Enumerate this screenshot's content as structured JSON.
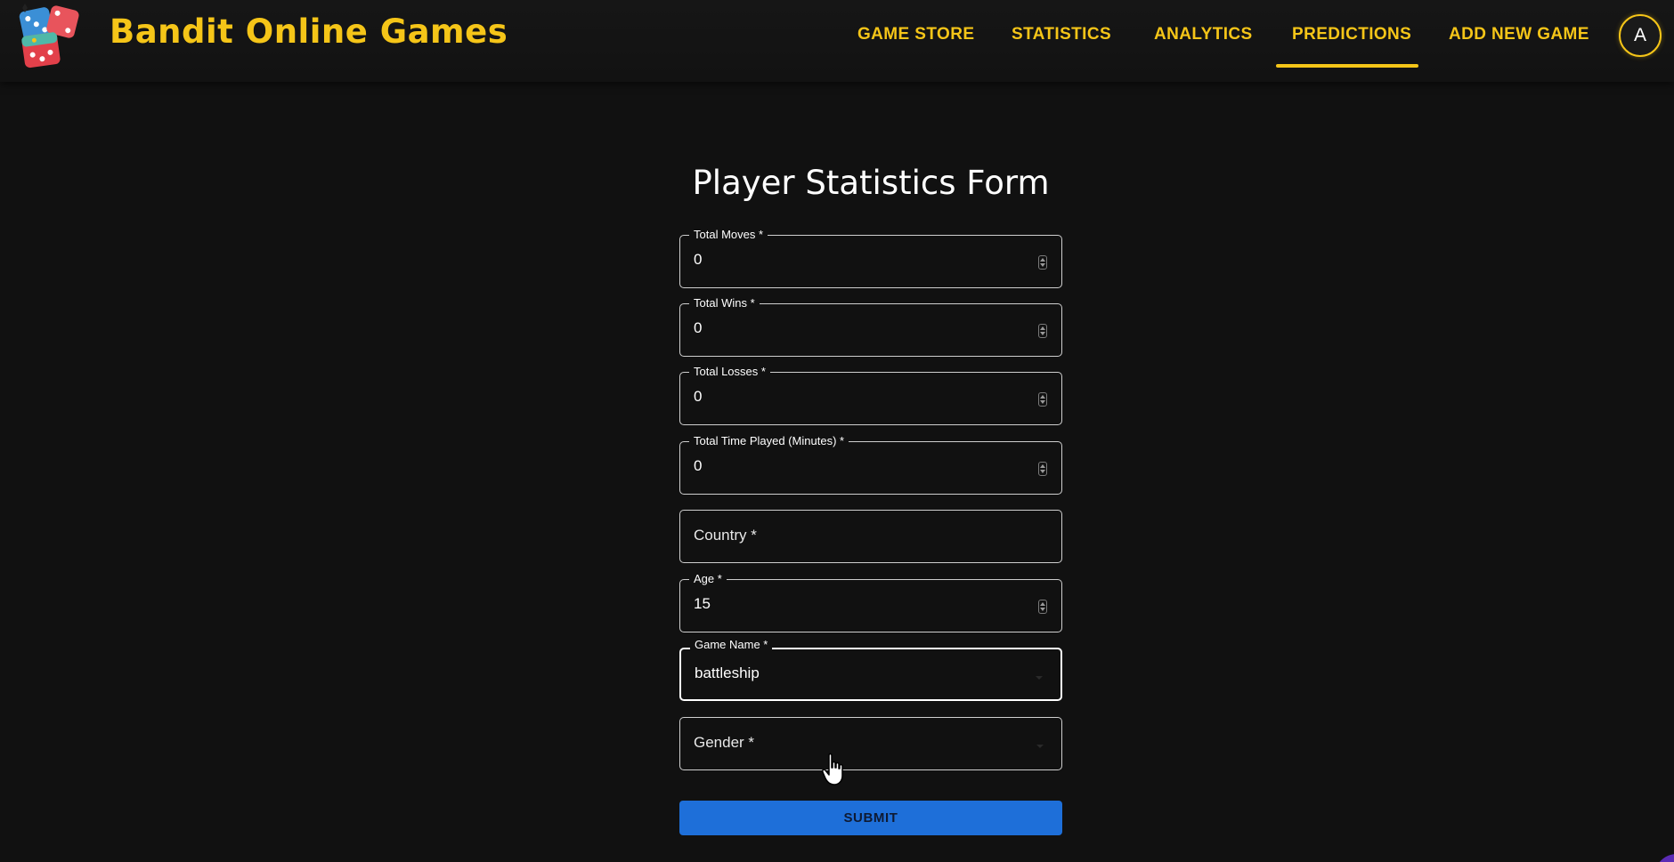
{
  "header": {
    "brand": "Bandit Online Games",
    "logo_icon": "dice-logo-icon",
    "nav": [
      {
        "label": "GAME STORE",
        "active": false
      },
      {
        "label": "STATISTICS",
        "active": false
      },
      {
        "label": "ANALYTICS",
        "active": false
      },
      {
        "label": "PREDICTIONS",
        "active": true
      },
      {
        "label": "ADD NEW GAME",
        "active": false
      }
    ],
    "avatar_initial": "A",
    "accent_color": "#f5c518"
  },
  "form": {
    "title": "Player Statistics Form",
    "fields": {
      "total_moves": {
        "label": "Total Moves *",
        "value": "0"
      },
      "total_wins": {
        "label": "Total Wins *",
        "value": "0"
      },
      "total_losses": {
        "label": "Total Losses *",
        "value": "0"
      },
      "total_time": {
        "label": "Total Time Played (Minutes) *",
        "value": "0"
      },
      "country": {
        "placeholder": "Country *",
        "value": ""
      },
      "age": {
        "label": "Age *",
        "value": "15"
      },
      "game_name": {
        "label": "Game Name *",
        "value": "battleship"
      },
      "gender": {
        "placeholder": "Gender *",
        "value": ""
      }
    },
    "submit_label": "SUBMIT",
    "submit_color": "#1e6fd9"
  }
}
